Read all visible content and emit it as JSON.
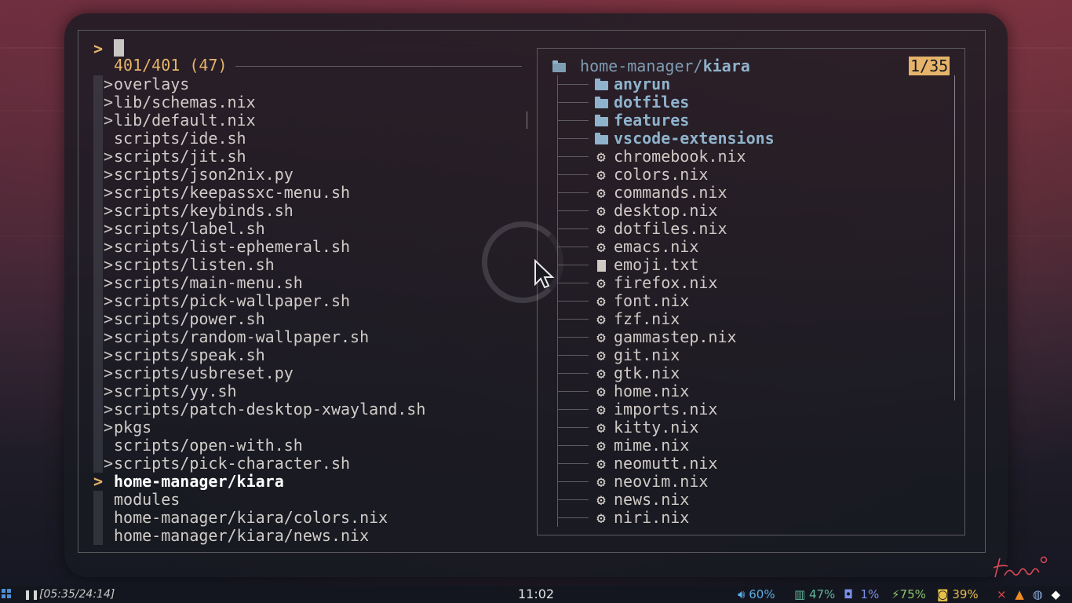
{
  "prompt": {
    "symbol": ">",
    "query": ""
  },
  "match_count": "401/401 (47)",
  "results": [
    {
      "mark": ">",
      "path": "overlays"
    },
    {
      "mark": ">",
      "path": "lib/schemas.nix"
    },
    {
      "mark": ">",
      "path": "lib/default.nix"
    },
    {
      "mark": "",
      "path": "scripts/ide.sh"
    },
    {
      "mark": ">",
      "path": "scripts/jit.sh"
    },
    {
      "mark": ">",
      "path": "scripts/json2nix.py"
    },
    {
      "mark": ">",
      "path": "scripts/keepassxc-menu.sh"
    },
    {
      "mark": ">",
      "path": "scripts/keybinds.sh"
    },
    {
      "mark": ">",
      "path": "scripts/label.sh"
    },
    {
      "mark": ">",
      "path": "scripts/list-ephemeral.sh"
    },
    {
      "mark": ">",
      "path": "scripts/listen.sh"
    },
    {
      "mark": ">",
      "path": "scripts/main-menu.sh"
    },
    {
      "mark": ">",
      "path": "scripts/pick-wallpaper.sh"
    },
    {
      "mark": ">",
      "path": "scripts/power.sh"
    },
    {
      "mark": ">",
      "path": "scripts/random-wallpaper.sh"
    },
    {
      "mark": ">",
      "path": "scripts/speak.sh"
    },
    {
      "mark": ">",
      "path": "scripts/usbreset.py"
    },
    {
      "mark": ">",
      "path": "scripts/yy.sh"
    },
    {
      "mark": ">",
      "path": "scripts/patch-desktop-xwayland.sh"
    },
    {
      "mark": ">",
      "path": "pkgs"
    },
    {
      "mark": "",
      "path": "scripts/open-with.sh"
    },
    {
      "mark": ">",
      "path": "scripts/pick-character.sh"
    }
  ],
  "selected": {
    "marker": ">",
    "path": "home-manager/kiara"
  },
  "results_after": [
    {
      "path": "modules"
    },
    {
      "path": "home-manager/kiara/colors.nix"
    },
    {
      "path": "home-manager/kiara/news.nix"
    }
  ],
  "preview": {
    "root_dir": "home-manager/",
    "root_name": "kiara",
    "counter": "1/35",
    "entries": [
      {
        "type": "dir",
        "icon": "folder-icon",
        "name": "anyrun"
      },
      {
        "type": "dir",
        "icon": "folder-icon",
        "name": "dotfiles"
      },
      {
        "type": "dir",
        "icon": "folder-icon",
        "name": "features"
      },
      {
        "type": "dir",
        "icon": "folder-icon",
        "name": "vscode-extensions"
      },
      {
        "type": "file",
        "icon": "gear-icon",
        "name": "chromebook.nix"
      },
      {
        "type": "file",
        "icon": "gear-icon",
        "name": "colors.nix"
      },
      {
        "type": "file",
        "icon": "gear-icon",
        "name": "commands.nix"
      },
      {
        "type": "file",
        "icon": "gear-icon",
        "name": "desktop.nix"
      },
      {
        "type": "file",
        "icon": "gear-icon",
        "name": "dotfiles.nix"
      },
      {
        "type": "file",
        "icon": "gear-icon",
        "name": "emacs.nix"
      },
      {
        "type": "file",
        "icon": "document-icon",
        "name": "emoji.txt"
      },
      {
        "type": "file",
        "icon": "gear-icon",
        "name": "firefox.nix"
      },
      {
        "type": "file",
        "icon": "gear-icon",
        "name": "font.nix"
      },
      {
        "type": "file",
        "icon": "gear-icon",
        "name": "fzf.nix"
      },
      {
        "type": "file",
        "icon": "gear-icon",
        "name": "gammastep.nix"
      },
      {
        "type": "file",
        "icon": "gear-icon",
        "name": "git.nix"
      },
      {
        "type": "file",
        "icon": "gear-icon",
        "name": "gtk.nix"
      },
      {
        "type": "file",
        "icon": "gear-icon",
        "name": "home.nix"
      },
      {
        "type": "file",
        "icon": "gear-icon",
        "name": "imports.nix"
      },
      {
        "type": "file",
        "icon": "gear-icon",
        "name": "kitty.nix"
      },
      {
        "type": "file",
        "icon": "gear-icon",
        "name": "mime.nix"
      },
      {
        "type": "file",
        "icon": "gear-icon",
        "name": "neomutt.nix"
      },
      {
        "type": "file",
        "icon": "gear-icon",
        "name": "neovim.nix"
      },
      {
        "type": "file",
        "icon": "gear-icon",
        "name": "news.nix"
      },
      {
        "type": "file",
        "icon": "gear-icon",
        "name": "niri.nix"
      }
    ]
  },
  "statusbar": {
    "timer": "[05:35/24:14]",
    "clock": "11:02",
    "volume": "60%",
    "memory": "47%",
    "cpu": "1%",
    "battery": "75%",
    "brightness": "39%"
  },
  "colors": {
    "accent": "#e6b36a",
    "dir": "#8fb3cc",
    "text": "#d0ccc8"
  }
}
